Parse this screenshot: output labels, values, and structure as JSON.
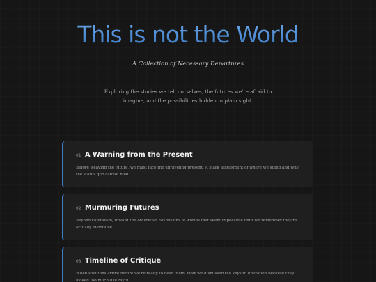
{
  "hero": {
    "title": "This is not the World",
    "subtitle": "A Collection of Necessary Departures",
    "intro": "Exploring the stories we tell ourselves, the futures we're afraid to imagine, and the possibilities hidden in plain sight."
  },
  "cards": [
    {
      "number": "01",
      "title": "A Warning from the Present",
      "description": "Before weaving the future, we must face the unraveling present. A stark assessment of where we stand and why the status quo cannot hold."
    },
    {
      "number": "02",
      "title": "Murmuring Futures",
      "description": "Beyond capitalism, toward the otherwise. Six visions of worlds that seem impossible until we remember they're actually inevitable."
    },
    {
      "number": "03",
      "title": "Timeline of Critique",
      "description": "When solutions arrive before we're ready to hear them. How we dismissed the keys to liberation because they looked too much like Myth."
    }
  ],
  "colors": {
    "accent": "#3f7fc4",
    "title_gradient_top": "#6aa8ea",
    "title_gradient_bottom": "#3a78c2",
    "background": "#161616",
    "card_background": "#1f1f1f"
  }
}
